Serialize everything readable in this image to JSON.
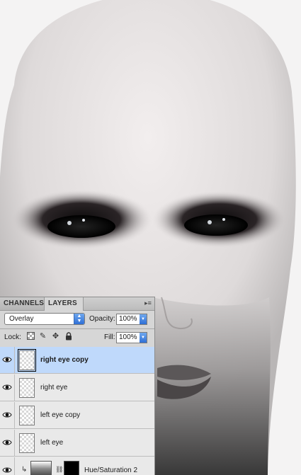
{
  "panel": {
    "tabs": [
      {
        "label": "CHANNELS",
        "active": false
      },
      {
        "label": "LAYERS",
        "active": true
      }
    ],
    "blend_mode": "Overlay",
    "opacity_label": "Opacity:",
    "opacity_value": "100%",
    "lock_label": "Lock:",
    "fill_label": "Fill:",
    "fill_value": "100%",
    "menu_icon": "panel-menu-icon"
  },
  "layers": [
    {
      "name": "right eye copy",
      "visible": true,
      "selected": true
    },
    {
      "name": "right eye",
      "visible": true,
      "selected": false
    },
    {
      "name": "left eye copy",
      "visible": true,
      "selected": false
    },
    {
      "name": "left eye",
      "visible": true,
      "selected": false
    },
    {
      "name": "Hue/Saturation 2",
      "visible": true,
      "selected": false,
      "type": "adjustment"
    }
  ],
  "colors": {
    "selected_row": "#bfd9fb",
    "panel_bg": "#d6d6d6",
    "accent": "#2f6fd6"
  }
}
